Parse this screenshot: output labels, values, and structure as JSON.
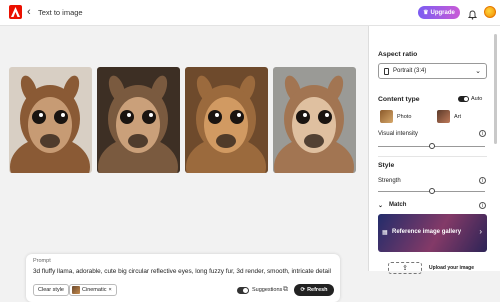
{
  "header": {
    "breadcrumb": "Text to image",
    "upgrade_label": "Upgrade"
  },
  "images": [
    {
      "alt": "llama-1",
      "bg": "#d8cfc4",
      "fur": "#8a5a35",
      "face": "#c79b74"
    },
    {
      "alt": "llama-2",
      "bg": "#3d2f24",
      "fur": "#7a5a3f",
      "face": "#caa07a"
    },
    {
      "alt": "llama-3",
      "bg": "#6e4a2c",
      "fur": "#9b6a3d",
      "face": "#d19a62"
    },
    {
      "alt": "llama-4",
      "bg": "#9a9a96",
      "fur": "#a27552",
      "face": "#dfc0a0"
    }
  ],
  "prompt": {
    "label": "Prompt",
    "text": "3d fluffy llama, adorable, cute big circular reflective eyes, long fuzzy fur, 3d render, smooth, intricate detail",
    "clear_label": "Clear style",
    "style_chip": "Cinematic",
    "suggestions_label": "Suggestions",
    "refresh_label": "Refresh"
  },
  "panel": {
    "aspect_ratio_heading": "Aspect ratio",
    "aspect_ratio_value": "Portrait (3:4)",
    "content_type_heading": "Content type",
    "auto_label": "Auto",
    "content_options": [
      "Photo",
      "Art"
    ],
    "visual_intensity_label": "Visual intensity",
    "visual_intensity_value": 0.5,
    "style_heading": "Style",
    "strength_label": "Strength",
    "strength_value": 0.5,
    "match_label": "Match",
    "gallery_label": "Reference image gallery",
    "upload_label": "Upload your image"
  },
  "colors": {
    "accent_start": "#7b5cf2",
    "accent_end": "#c95bd6",
    "brand": "#eb1000"
  }
}
